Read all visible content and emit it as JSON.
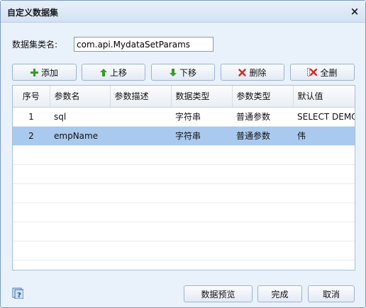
{
  "dialog": {
    "title": "自定义数据集",
    "close_glyph": "×"
  },
  "form": {
    "name_label": "数据集类名:",
    "name_value": "com.api.MydataSetParams"
  },
  "toolbar": {
    "add": "添加",
    "up": "上移",
    "down": "下移",
    "delete": "删除",
    "delete_all": "全删"
  },
  "grid": {
    "columns": [
      "序号",
      "参数名",
      "参数描述",
      "数据类型",
      "参数类型",
      "默认值"
    ],
    "rows": [
      {
        "index": "1",
        "name": "sql",
        "desc": "",
        "data_type": "字符串",
        "param_type": "普通参数",
        "default": "SELECT DEMO",
        "selected": false
      },
      {
        "index": "2",
        "name": "empName",
        "desc": "",
        "data_type": "字符串",
        "param_type": "普通参数",
        "default": "伟",
        "selected": true
      }
    ]
  },
  "footer": {
    "preview": "数据预览",
    "ok": "完成",
    "cancel": "取消"
  },
  "colors": {
    "selected_row": "#aac9ee",
    "add_icon": "#3a9b2a",
    "arrow_icon": "#3a9b2a",
    "delete_icon": "#d62b1f"
  },
  "icons": {
    "add": "plus-icon",
    "up": "arrow-up-icon",
    "down": "arrow-down-icon",
    "delete": "x-icon",
    "delete_all": "x-grid-icon",
    "help": "help-icon"
  }
}
